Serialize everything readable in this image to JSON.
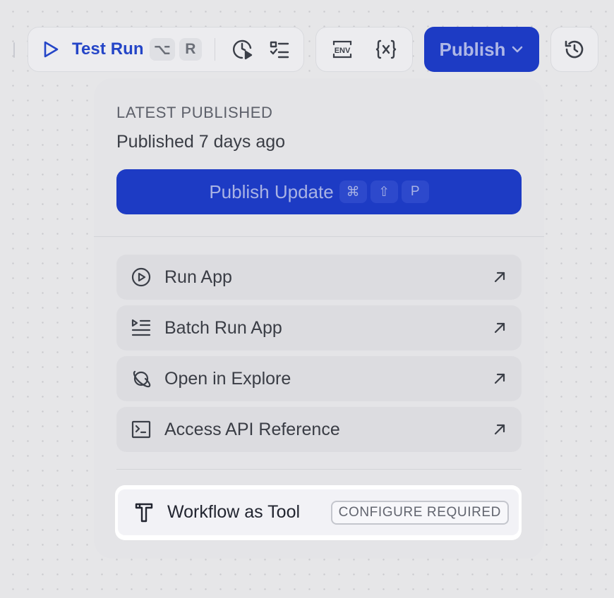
{
  "toolbar": {
    "test_run_label": "Test Run",
    "test_run_shortcut": [
      "⌥",
      "R"
    ],
    "publish_label": "Publish",
    "icons": [
      "play-icon",
      "checklist-run-icon",
      "checklist-icon",
      "env-icon",
      "variable-icon",
      "chevron-down-icon",
      "history-icon"
    ],
    "env_text": "ENV"
  },
  "panel": {
    "latest_label": "LATEST PUBLISHED",
    "published_time": "Published 7 days ago",
    "publish_update_label": "Publish Update",
    "publish_update_shortcut": [
      "⌘",
      "⇧",
      "P"
    ],
    "menu_items": [
      {
        "label": "Run App",
        "icon": "play-circle-icon"
      },
      {
        "label": "Batch Run App",
        "icon": "batch-run-icon"
      },
      {
        "label": "Open in Explore",
        "icon": "explore-planet-icon"
      },
      {
        "label": "Access API Reference",
        "icon": "terminal-icon"
      }
    ],
    "workflow_tool": {
      "label": "Workflow as Tool",
      "badge": "CONFIGURE REQUIRED",
      "icon": "tool-icon"
    }
  },
  "colors": {
    "brand": "#1d3bc4",
    "accent_text": "#2445c7",
    "canvas": "#e6e6e8"
  }
}
